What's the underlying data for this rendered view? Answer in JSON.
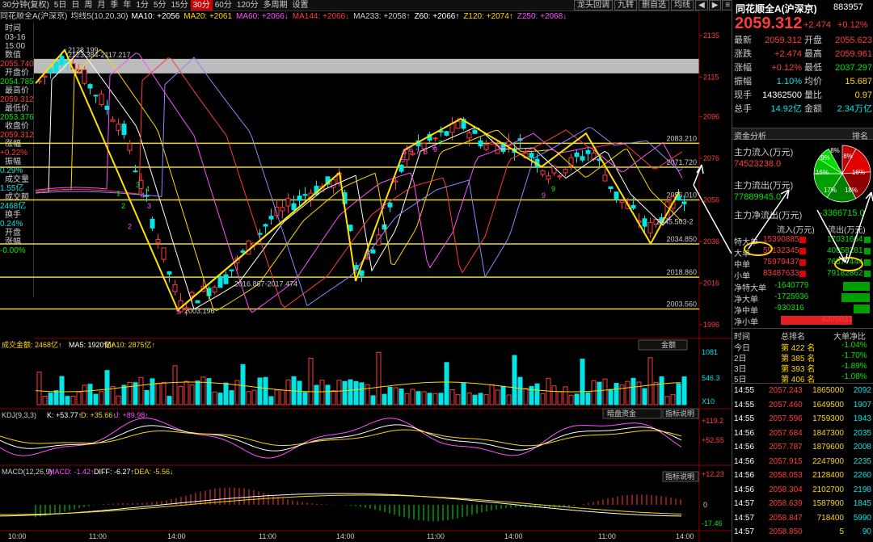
{
  "toolbar": {
    "tabs": [
      "30分钟(复权)",
      "5日",
      "日",
      "周",
      "月",
      "季",
      "年",
      "1分",
      "5分",
      "15分",
      "30分",
      "60分",
      "120分",
      "多周期",
      "设置"
    ],
    "active_tab": 10,
    "right_tabs": [
      "龙头回调",
      "九转",
      "删自选",
      "均线"
    ],
    "window_icons": [
      "◀",
      "▶",
      "≡",
      "⊞",
      "✕"
    ]
  },
  "ma_bar": {
    "stock": "同花顺全A(沪深京)",
    "label": "均线5(10,20,30)",
    "items": [
      {
        "text": "MA10: +2056",
        "color": "#ffffff"
      },
      {
        "text": "MA20: +2061",
        "color": "#ffd700"
      },
      {
        "text": "MA60: +2066↓",
        "color": "#ff4fff"
      },
      {
        "text": "MA144: +2066↓",
        "color": "#ff3b3b"
      },
      {
        "text": "MA233: +2058↑",
        "color": "#cccccc"
      },
      {
        "text": "Z60: +2066↑",
        "color": "#ffffff"
      },
      {
        "text": "Z120: +2074↑",
        "color": "#ffd700"
      },
      {
        "text": "Z250: +2068↓",
        "color": "#ff4fff"
      }
    ]
  },
  "left_info": {
    "date": "03-16",
    "time": "15:00",
    "items": [
      {
        "label": "时间",
        "value": "",
        "color": "#ccc"
      },
      {
        "label": "数值",
        "value": "2055.740",
        "color": "#ff3b3b"
      },
      {
        "label": "开盘价",
        "value": "2054.785",
        "color": "#00e600"
      },
      {
        "label": "最高价",
        "value": "2059.312",
        "color": "#ff3b3b"
      },
      {
        "label": "最低价",
        "value": "2053.376",
        "color": "#00e600"
      },
      {
        "label": "收盘价",
        "value": "2059.312",
        "color": "#ff3b3b"
      },
      {
        "label": "涨幅",
        "value": "+0.22%",
        "color": "#ff3b3b"
      },
      {
        "label": "振幅",
        "value": "0.29%",
        "color": "#00e5e5"
      },
      {
        "label": "成交量",
        "value": "1.55亿",
        "color": "#00e5e5"
      },
      {
        "label": "成交额",
        "value": "2468亿",
        "color": "#00e5e5"
      },
      {
        "label": "换手",
        "value": "0.24%",
        "color": "#00e5e5"
      },
      {
        "label": "开盘",
        "value": "",
        "color": "#ccc"
      },
      {
        "label": "涨幅",
        "value": "-0.00%",
        "color": "#00e600"
      }
    ]
  },
  "price_axis": [
    "2135",
    "2115",
    "2096",
    "2076",
    "2056",
    "2036",
    "2016",
    "1996"
  ],
  "levels": [
    {
      "price": "2083.210"
    },
    {
      "price": "2071.720"
    },
    {
      "price": "2056.010"
    },
    {
      "price": "2034.850"
    },
    {
      "price": "2018.860"
    },
    {
      "price": "2003.560"
    }
  ],
  "annotations": {
    "high": "2128.199",
    "high_range": "2123.384-2117.217",
    "low": "2003.196",
    "mid_range": "2016.867-2017.474",
    "right_range": "2045.503-2"
  },
  "td_numbers": [
    "9",
    "2",
    "3",
    "4",
    "2",
    "5",
    "9",
    "9",
    "5",
    "6",
    "7",
    "8",
    "9",
    "9",
    "1",
    "2",
    "3",
    "4",
    "7"
  ],
  "volume": {
    "title": "成交金额: 2468亿↑",
    "ma5": "MA5: 1920亿↑",
    "ma10": "MA10: 2875亿↑",
    "btn": "金额",
    "axis": [
      "1081",
      "546.3",
      "X10"
    ]
  },
  "kdj": {
    "title": "KDJ(9,3,3)",
    "k": "K: +53.77↑",
    "d": "D: +35.66↑",
    "j": "J: +89.98↑",
    "btn1": "暗盘资金",
    "btn2": "指标说明",
    "axis": [
      "+119.2",
      "+52.55"
    ]
  },
  "macd": {
    "title": "MACD(12,26,9)",
    "macd": "MACD: -1.42↑",
    "diff": "DIFF: -6.27↑",
    "dea": "DEA: -5.56↓",
    "btn": "指标说明",
    "axis": [
      "+12.23",
      "0",
      "-17.46"
    ]
  },
  "time_axis": [
    "10:00",
    "11:00",
    "14:00",
    "11:00",
    "14:00",
    "11:00",
    "14:00",
    "11:00",
    "14:00"
  ],
  "right_panel": {
    "name": "同花顺全A(沪深京)",
    "code": "883957",
    "price": "2059.312",
    "change": "+2.474",
    "pct": "+0.12%",
    "quote": [
      {
        "l1": "最新",
        "v1": "2059.312",
        "c1": "#ff3b3b",
        "l2": "开盘",
        "v2": "2055.623",
        "c2": "#ff3b3b"
      },
      {
        "l1": "涨跌",
        "v1": "+2.474",
        "c1": "#ff3b3b",
        "l2": "最高",
        "v2": "2059.961",
        "c2": "#ff3b3b"
      },
      {
        "l1": "涨幅",
        "v1": "+0.12%",
        "c1": "#ff3b3b",
        "l2": "最低",
        "v2": "2037.297",
        "c2": "#00e600"
      },
      {
        "l1": "振幅",
        "v1": "1.10%",
        "c1": "#00e5e5",
        "l2": "均价",
        "v2": "15.687",
        "c2": "#ffd700"
      },
      {
        "l1": "现手",
        "v1": "14362500",
        "c1": "#fff",
        "l2": "量比",
        "v2": "0.97",
        "c2": "#ffd700"
      },
      {
        "l1": "总手",
        "v1": "14.92亿",
        "c1": "#00e5e5",
        "l2": "金额",
        "v2": "2.34万亿",
        "c2": "#00e5e5"
      }
    ],
    "fund_title": "资金分析",
    "fund_rank": "排名",
    "main_in_label": "主力流入(万元)",
    "main_in": "74523238.0",
    "main_out_label": "主力流出(万元)",
    "main_out": "77889945.0",
    "net_label": "主力净流出(万元)",
    "net": "-3366715.0",
    "pie": [
      {
        "pct": "8%",
        "color": "#c00000"
      },
      {
        "pct": "16%",
        "color": "#e00000"
      },
      {
        "pct": "18%",
        "color": "#900000"
      },
      {
        "pct": "17%",
        "color": "#008000"
      },
      {
        "pct": "16%",
        "color": "#00a000"
      },
      {
        "pct": "9%",
        "color": "#00c000"
      },
      {
        "pct": "8%",
        "color": "#00e000"
      }
    ],
    "flow_head": [
      "流入(万元)",
      "流出(万元)"
    ],
    "flow": [
      {
        "label": "特大单",
        "in": "15390885",
        "out": "17031664"
      },
      {
        "label": "大单",
        "in": "59132345",
        "out": "40858281"
      },
      {
        "label": "中单",
        "in": "75979437",
        "out": "76577444"
      },
      {
        "label": "小单",
        "in": "83487633",
        "out": "79182862"
      }
    ],
    "net_rows": [
      {
        "label": "净特大单",
        "value": "-1640779",
        "color": "#00e600",
        "bar": 0.3,
        "neg": true
      },
      {
        "label": "净大单",
        "value": "-1725936",
        "color": "#00e600",
        "bar": 0.32,
        "neg": true
      },
      {
        "label": "净中单",
        "value": "-930316",
        "color": "#00e600",
        "bar": 0.18,
        "neg": true
      },
      {
        "label": "净小单",
        "value": "4305031",
        "color": "#ff3b3b",
        "bar": 0.8,
        "neg": false
      }
    ],
    "rank_head": [
      "时间",
      "总排名",
      "大单净比"
    ],
    "ranks": [
      {
        "t": "今日",
        "r": "第 422 名",
        "v": "-1.04%"
      },
      {
        "t": "2日",
        "r": "第 385 名",
        "v": "-1.70%"
      },
      {
        "t": "3日",
        "r": "第 393 名",
        "v": "-1.89%"
      },
      {
        "t": "5日",
        "r": "第 406 名",
        "v": "-1.08%"
      }
    ],
    "ticks": [
      {
        "t": "14:55",
        "p": "2057.243",
        "v": "1865000",
        "a": "2092"
      },
      {
        "t": "14:55",
        "p": "2057.460",
        "v": "1649500",
        "a": "1907"
      },
      {
        "t": "14:55",
        "p": "2057.596",
        "v": "1759300",
        "a": "1943"
      },
      {
        "t": "14:56",
        "p": "2057.684",
        "v": "1847300",
        "a": "2035"
      },
      {
        "t": "14:56",
        "p": "2057.787",
        "v": "1879600",
        "a": "2008"
      },
      {
        "t": "14:56",
        "p": "2057.915",
        "v": "2247900",
        "a": "2235"
      },
      {
        "t": "14:56",
        "p": "2058.053",
        "v": "2128400",
        "a": "2260"
      },
      {
        "t": "14:56",
        "p": "2058.304",
        "v": "2102700",
        "a": "2198"
      },
      {
        "t": "14:57",
        "p": "2058.639",
        "v": "1587900",
        "a": "1845"
      },
      {
        "t": "14:57",
        "p": "2058.847",
        "v": "718400",
        "a": "5990"
      },
      {
        "t": "14:57",
        "p": "2058.850",
        "v": "5",
        "a": "90"
      }
    ]
  }
}
